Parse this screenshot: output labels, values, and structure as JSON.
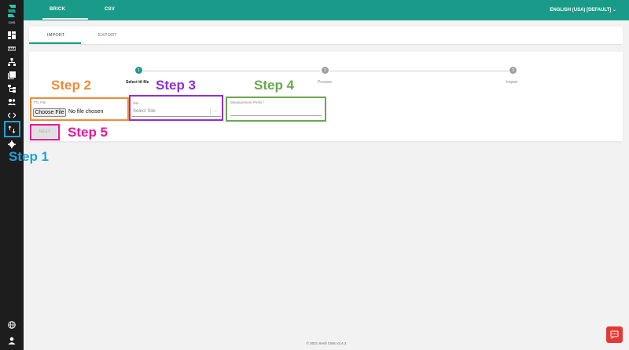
{
  "sidebar": {
    "cms_label": "CMS"
  },
  "topbar": {
    "tabs": [
      {
        "label": "BRICK"
      },
      {
        "label": "CSV"
      }
    ],
    "language": "ENGLISH (USA) [DEFAULT] ⌄"
  },
  "subtabs": [
    {
      "label": "IMPORT"
    },
    {
      "label": "EXPORT"
    }
  ],
  "stepper": {
    "steps": [
      {
        "number": "1",
        "label": "Select ttl file"
      },
      {
        "number": "2",
        "label": "Preview"
      },
      {
        "number": "3",
        "label": "Import"
      }
    ]
  },
  "form": {
    "ttl_label": "TTL File",
    "file_button": "Choose File",
    "file_status": "No file chosen",
    "site_label": "Site",
    "site_placeholder": "Select Site",
    "site_chevron": "⌵",
    "prefix_label": "Measurement Prefix *",
    "next_button": "NEXT"
  },
  "annotations": {
    "step1": {
      "text": "Step 1",
      "color": "#1ea3d9"
    },
    "step2": {
      "text": "Step 2",
      "color": "#ef8a3a"
    },
    "step3": {
      "text": "Step 3",
      "color": "#8e2fd6"
    },
    "step4": {
      "text": "Step 4",
      "color": "#6aa84f"
    },
    "step5": {
      "text": "Step 5",
      "color": "#e8199a"
    }
  },
  "footer": "© 2021 Senfi CMS v2.4.3",
  "colors": {
    "brand": "#1a9b8a",
    "sidebar": "#1d1d1d",
    "chat": "#e53935"
  }
}
